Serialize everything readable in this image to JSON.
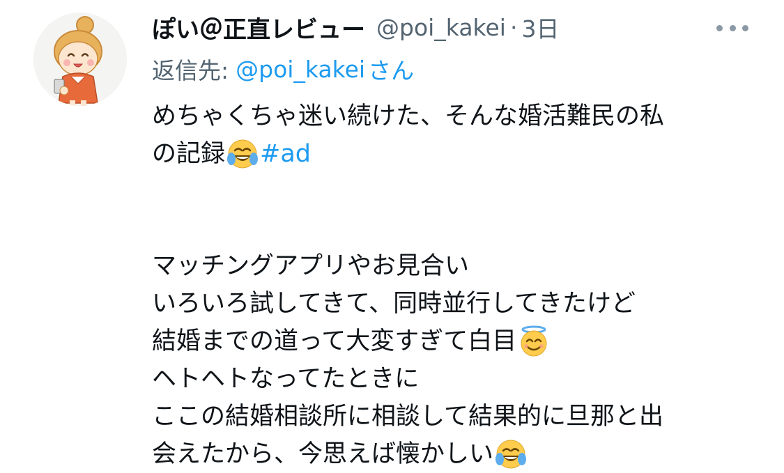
{
  "tweet": {
    "display_name": "ぽい＠正直レビュー",
    "handle": "@poi_kakei",
    "separator": "·",
    "time": "3日",
    "more_icon": "more-horizontal-icon",
    "reply": {
      "label": "返信先:",
      "target": "@poi_kakei",
      "suffix": "さん"
    },
    "body": {
      "line1": "めちゃくちゃ迷い続けた、そんな婚活難民の私",
      "line2_text": "の記録",
      "line2_emoji": "face-with-tears-of-joy-icon",
      "hashtag": "#ad",
      "line3": "マッチングアプリやお見合い",
      "line4": "いろいろ試してきて、同時並行してきたけど",
      "line5_text": "結婚までの道って大変すぎて白目",
      "line5_emoji": "smiling-face-with-halo-icon",
      "line6": "ヘトヘトなってたときに",
      "line7": "ここの結婚相談所に相談して結果的に旦那と出",
      "line8_text": "会えたから、今思えば懐かしい",
      "line8_emoji": "face-with-tears-of-joy-icon"
    }
  }
}
